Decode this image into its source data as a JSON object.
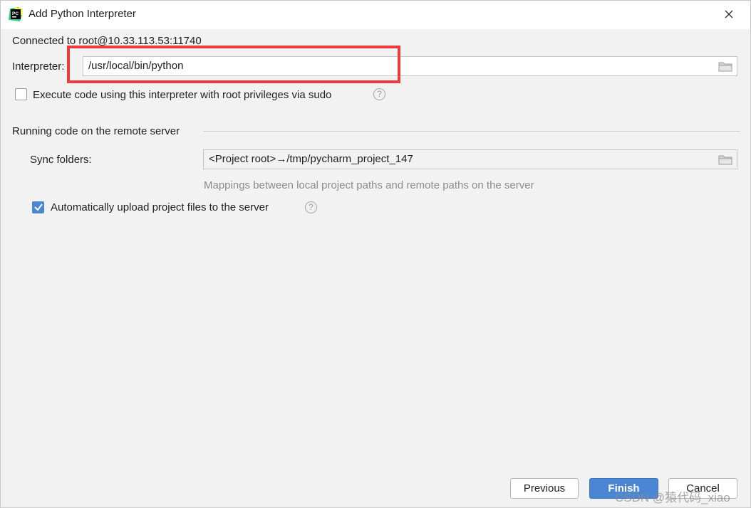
{
  "window": {
    "title": "Add Python Interpreter",
    "close_symbol": "✕"
  },
  "connection": {
    "text": "Connected to root@10.33.113.53:11740"
  },
  "interpreter": {
    "label": "Interpreter:",
    "value": "/usr/local/bin/python"
  },
  "sudo": {
    "label": "Execute code using this interpreter with root privileges via sudo",
    "checked": false
  },
  "remote_section": {
    "title": "Running code on the remote server",
    "sync_label": "Sync folders:",
    "sync_value": "<Project root>→/tmp/pycharm_project_147",
    "hint": "Mappings between local project paths and remote paths on the server",
    "auto_upload_label": "Automatically upload project files to the server",
    "auto_upload_checked": true
  },
  "help_symbol": "?",
  "buttons": {
    "previous": "Previous",
    "finish": "Finish",
    "cancel": "Cancel"
  },
  "watermark": "CSDN @猿代码_xiao",
  "colors": {
    "accent": "#4a86d4",
    "highlight_box": "#ee3b3b",
    "background": "#f2f2f2"
  }
}
